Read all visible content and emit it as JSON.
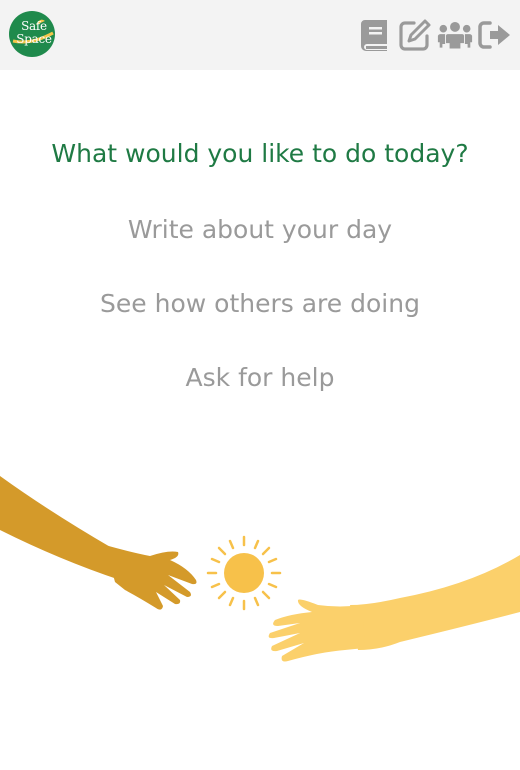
{
  "app": {
    "logo_line1": "Safe",
    "logo_line2": "Space"
  },
  "nav": {
    "icons": [
      "book-icon",
      "edit-icon",
      "group-icon",
      "sign-out-icon"
    ]
  },
  "main": {
    "heading": "What would you like to do today?",
    "options": [
      {
        "label": "Write about your day"
      },
      {
        "label": "See how others are doing"
      },
      {
        "label": "Ask for help"
      }
    ]
  },
  "colors": {
    "brand_green": "#1f8a4c",
    "heading_green": "#1f7a44",
    "menu_gray": "#9a9a9a",
    "icon_gray": "#9a9a9a",
    "header_bg": "#f3f3f3",
    "hand_left": "#d49a2a",
    "hand_right": "#fbd06b",
    "sun": "#f7c14a"
  }
}
